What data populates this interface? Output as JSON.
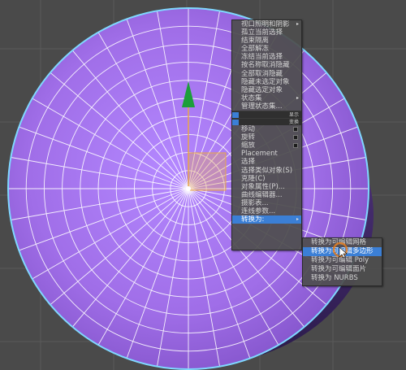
{
  "colors": {
    "viewport_bg": "#4a4a4a",
    "sphere_fill": "#a06ee8",
    "wire": "#ffffff",
    "outline": "#7fd8ff",
    "highlight": "#3b7fd6",
    "gizmo_axis": "#e8a64a",
    "gizmo_arrow": "#1c9e3a",
    "cursor_ring": "#e07a1e"
  },
  "quad_menu": {
    "items": [
      {
        "label": "视口照明和阴影",
        "submenu": true
      },
      {
        "label": "孤立当前选择"
      },
      {
        "label": "结束隔离"
      },
      {
        "label": "全部解冻"
      },
      {
        "label": "冻结当前选择"
      },
      {
        "label": "按名称取消隐藏"
      },
      {
        "label": "全部取消隐藏"
      },
      {
        "label": "隐藏未选定对象"
      },
      {
        "label": "隐藏选定对象"
      },
      {
        "label": "状态集",
        "submenu": true
      },
      {
        "label": "管理状态集..."
      }
    ],
    "band_top": {
      "label": "显示",
      "arrow": "▸"
    },
    "band_bottom": {
      "label": "变换",
      "arrow": "▸"
    },
    "transform_items": [
      {
        "label": "移动",
        "option": true
      },
      {
        "label": "旋转",
        "option": true
      },
      {
        "label": "缩放",
        "option": true
      },
      {
        "label": "Placement"
      },
      {
        "label": "选择"
      },
      {
        "label": "选择类似对象(S)"
      },
      {
        "label": "克隆(C)"
      },
      {
        "label": "对象属性(P)..."
      },
      {
        "label": "曲线编辑器..."
      },
      {
        "label": "摄影表..."
      },
      {
        "label": "连线参数..."
      },
      {
        "label": "转换为:",
        "submenu": true,
        "highlighted": true
      }
    ]
  },
  "convert_submenu": {
    "items": [
      {
        "label": "转换为可编辑网格"
      },
      {
        "label": "转换为可编辑多边形",
        "highlighted": true
      },
      {
        "label": "转换为可编辑 Poly"
      },
      {
        "label": "转换为可编辑面片"
      },
      {
        "label": "转换为 NURBS"
      }
    ]
  },
  "icons": {
    "submenu_arrow": "▸",
    "gizmo": "move-gizmo-icon",
    "cursor": "mouse-pointer-icon"
  }
}
